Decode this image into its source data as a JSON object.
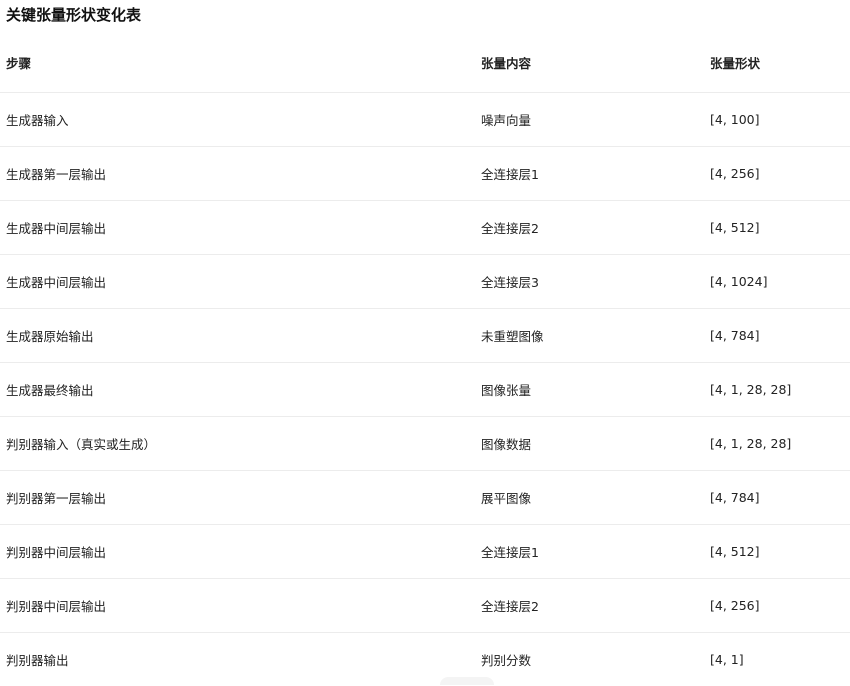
{
  "title": "关键张量形状变化表",
  "table": {
    "headers": [
      "步骤",
      "张量内容",
      "张量形状"
    ],
    "rows": [
      [
        "生成器输入",
        "噪声向量",
        "[4, 100]"
      ],
      [
        "生成器第一层输出",
        "全连接层1",
        "[4, 256]"
      ],
      [
        "生成器中间层输出",
        "全连接层2",
        "[4, 512]"
      ],
      [
        "生成器中间层输出",
        "全连接层3",
        "[4, 1024]"
      ],
      [
        "生成器原始输出",
        "未重塑图像",
        "[4, 784]"
      ],
      [
        "生成器最终输出",
        "图像张量",
        "[4, 1, 28, 28]"
      ],
      [
        "判别器输入（真实或生成）",
        "图像数据",
        "[4, 1, 28, 28]"
      ],
      [
        "判别器第一层输出",
        "展平图像",
        "[4, 784]"
      ],
      [
        "判别器中间层输出",
        "全连接层1",
        "[4, 512]"
      ],
      [
        "判别器中间层输出",
        "全连接层2",
        "[4, 256]"
      ],
      [
        "判别器输出",
        "判别分数",
        "[4, 1]"
      ]
    ]
  }
}
